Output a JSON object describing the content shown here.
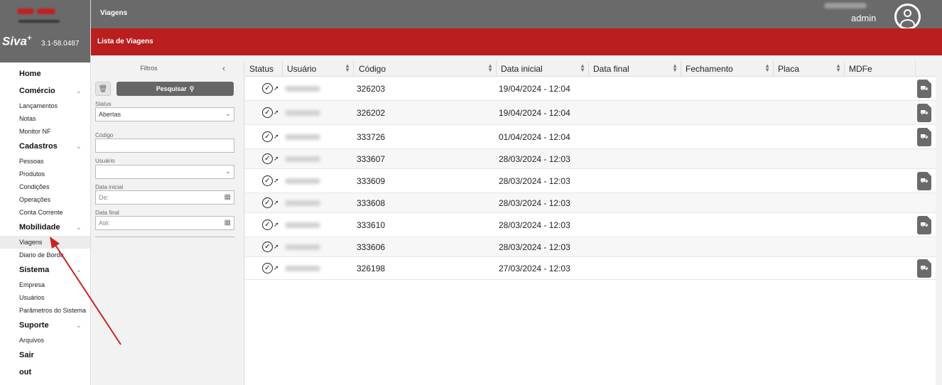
{
  "sidebar": {
    "brand": "Siva",
    "brand_sup": "+",
    "version": "3.1-58.0487",
    "sections": [
      {
        "label": "Home",
        "items": []
      },
      {
        "label": "Comércio",
        "items": [
          "Lançamentos",
          "Notas",
          "Monitor NF"
        ]
      },
      {
        "label": "Cadastros",
        "items": [
          "Pessoas",
          "Produtos",
          "Condições",
          "Operações",
          "Conta Corrente"
        ]
      },
      {
        "label": "Mobilidade",
        "items": [
          "Viagens",
          "Diario de Bordo"
        ]
      },
      {
        "label": "Sistema",
        "items": [
          "Empresa",
          "Usuários",
          "Parâmetros do Sistema"
        ]
      },
      {
        "label": "Suporte",
        "items": [
          "Arquivos"
        ]
      },
      {
        "label": "Sair",
        "items": []
      },
      {
        "label": "out",
        "items": []
      }
    ],
    "active_item": "Viagens"
  },
  "topbar": {
    "title": "Viagens",
    "user": "admin"
  },
  "page_header": {
    "title": "Lista de Viagens"
  },
  "filters": {
    "title": "Filtros",
    "collapse_icon": "chevron-left-icon",
    "search_label": "Pesquisar",
    "status_label": "Status",
    "status_value": "Abertas",
    "codigo_label": "Código",
    "codigo_value": "",
    "usuario_label": "Usuário",
    "usuario_value": "",
    "data_inicial_label": "Data inicial",
    "data_inicial_placeholder": "De:",
    "data_final_label": "Data final",
    "data_final_placeholder": "Até:"
  },
  "table": {
    "columns": [
      "Status",
      "Usuário",
      "Código",
      "Data inicial",
      "Data final",
      "Fechamento",
      "Placa",
      "MDFe"
    ],
    "rows": [
      {
        "codigo": "326203",
        "data_inicial": "19/04/2024 - 12:04",
        "mdfe": true
      },
      {
        "codigo": "326202",
        "data_inicial": "19/04/2024 - 12:04",
        "mdfe": true
      },
      {
        "codigo": "333726",
        "data_inicial": "01/04/2024 - 12:04",
        "mdfe": true
      },
      {
        "codigo": "333607",
        "data_inicial": "28/03/2024 - 12:03",
        "mdfe": false
      },
      {
        "codigo": "333609",
        "data_inicial": "28/03/2024 - 12:03",
        "mdfe": true
      },
      {
        "codigo": "333608",
        "data_inicial": "28/03/2024 - 12:03",
        "mdfe": false
      },
      {
        "codigo": "333610",
        "data_inicial": "28/03/2024 - 12:03",
        "mdfe": true
      },
      {
        "codigo": "333606",
        "data_inicial": "28/03/2024 - 12:03",
        "mdfe": false
      },
      {
        "codigo": "326198",
        "data_inicial": "27/03/2024 - 12:03",
        "mdfe": true
      }
    ]
  },
  "colors": {
    "header_gray": "#6a6a6a",
    "brand_red": "#bb1e1e",
    "annotation_red": "#cc2222"
  }
}
